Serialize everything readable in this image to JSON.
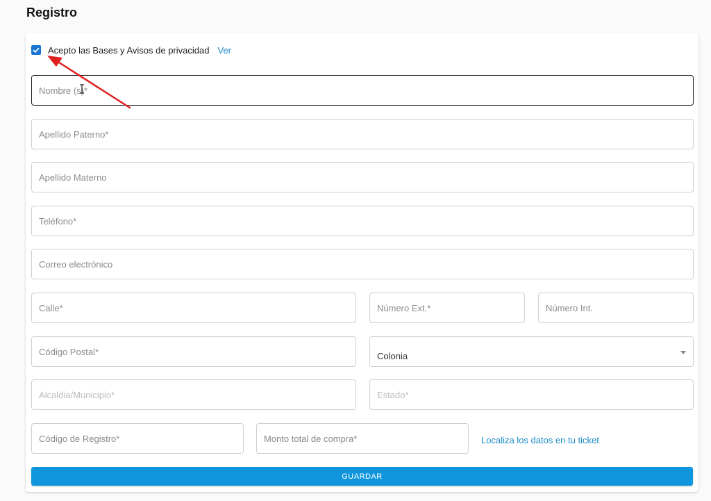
{
  "page": {
    "title": "Registro"
  },
  "consent": {
    "checked": true,
    "label": "Acepto las Bases y Avisos de privacidad",
    "link_label": "Ver"
  },
  "fields": {
    "nombre": "Nombre (s)*",
    "apellido_paterno": "Apellido Paterno*",
    "apellido_materno": "Apellido Materno",
    "telefono": "Teléfono*",
    "correo": "Correo electrónico",
    "calle": "Calle*",
    "numero_ext": "Número Ext.*",
    "numero_int": "Número Int.",
    "codigo_postal": "Código Postal*",
    "colonia": "Colonia",
    "alcaldia": "Alcaldia/Municipio*",
    "estado": "Estado*",
    "codigo_registro": "Código de Registro*",
    "monto": "Monto total de compra*"
  },
  "ticket_link": "Localiza los datos en tu ticket",
  "save_label": "GUARDAR",
  "colors": {
    "accent": "#0f96dc",
    "link": "#1a8ac4",
    "checkbox": "#1976d2",
    "annotation_arrow": "#e02020"
  }
}
